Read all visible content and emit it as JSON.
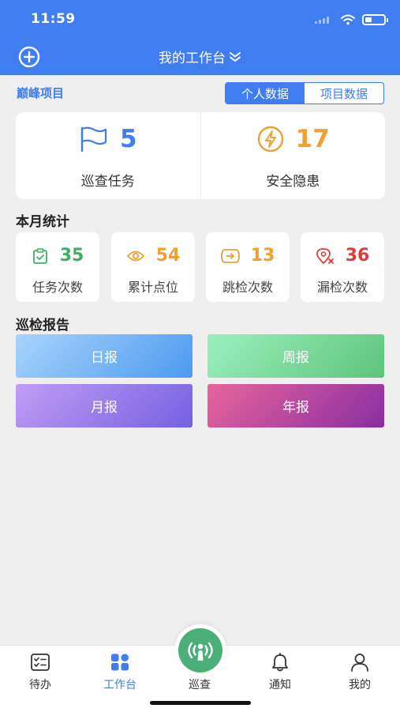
{
  "status_bar": {
    "time": "11:59"
  },
  "header": {
    "title": "我的工作台"
  },
  "project": {
    "name": "巅峰项目"
  },
  "segment": {
    "options": [
      "个人数据",
      "项目数据"
    ],
    "selected": "个人数据"
  },
  "summary": [
    {
      "value": "5",
      "label": "巡查任务",
      "icon": "flag-icon",
      "color": "#3f7df0"
    },
    {
      "value": "17",
      "label": "安全隐患",
      "icon": "lightning-icon",
      "color": "#f0a030"
    }
  ],
  "monthly": {
    "title": "本月统计",
    "items": [
      {
        "value": "35",
        "label": "任务次数",
        "icon": "clipboard-check-icon",
        "color": "#3fae5f"
      },
      {
        "value": "54",
        "label": "累计点位",
        "icon": "eye-icon",
        "color": "#f0a030"
      },
      {
        "value": "13",
        "label": "跳检次数",
        "icon": "skip-icon",
        "color": "#f0a030"
      },
      {
        "value": "36",
        "label": "漏检次数",
        "icon": "missed-location-icon",
        "color": "#e03b3b"
      }
    ]
  },
  "reports": {
    "title": "巡检报告",
    "items": [
      {
        "label": "日报",
        "gradient": [
          "#a9d4fb",
          "#4b9af0"
        ]
      },
      {
        "label": "周报",
        "gradient": [
          "#9af0bd",
          "#5ec47b"
        ]
      },
      {
        "label": "月报",
        "gradient": [
          "#c09ef5",
          "#7560e0"
        ]
      },
      {
        "label": "年报",
        "gradient": [
          "#e6659a",
          "#8a2ea3"
        ]
      }
    ]
  },
  "tabbar": {
    "items": [
      {
        "label": "待办",
        "icon": "todo-list-icon"
      },
      {
        "label": "工作台",
        "icon": "workbench-grid-icon",
        "active": true
      },
      {
        "label": "巡查",
        "icon": "patrol-broadcast-icon"
      },
      {
        "label": "通知",
        "icon": "bell-icon"
      },
      {
        "label": "我的",
        "icon": "user-icon"
      }
    ]
  },
  "colors": {
    "primary": "#3f7df0",
    "background": "#efefef",
    "patrol": "#4caf78"
  }
}
